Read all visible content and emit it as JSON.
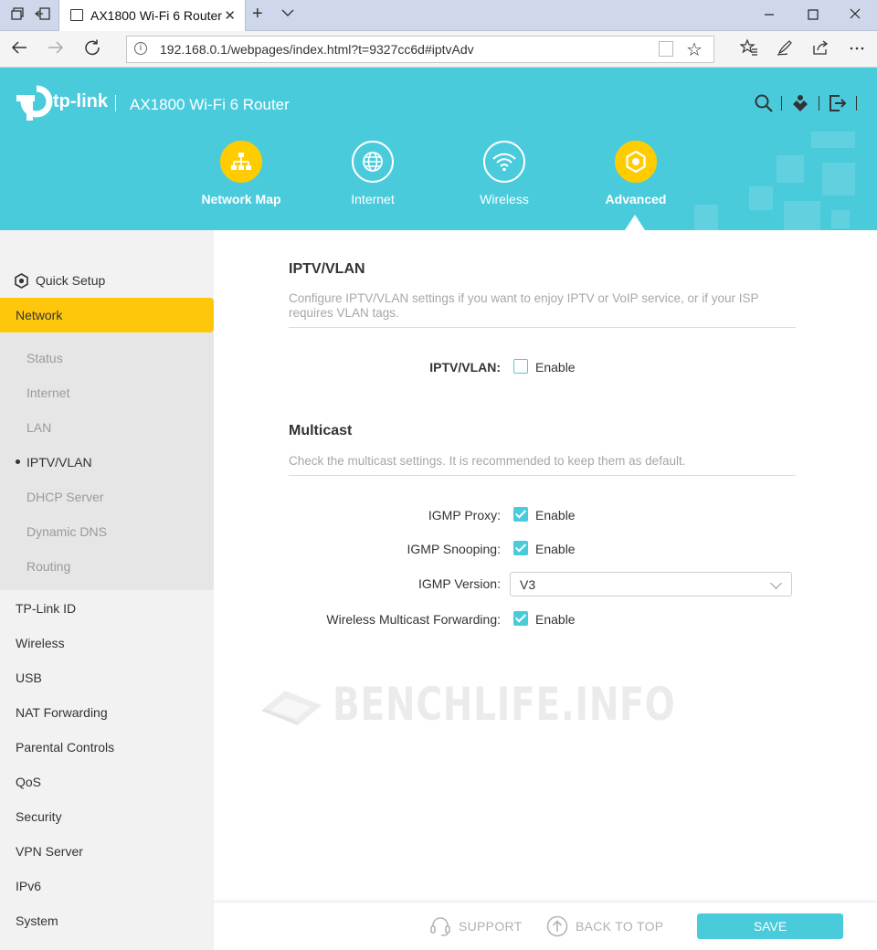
{
  "browser": {
    "tab_title": "AX1800 Wi-Fi 6 Router",
    "url": "192.168.0.1/webpages/index.html?t=9327cc6d#iptvAdv"
  },
  "header": {
    "brand": "tp-link",
    "model": "AX1800 Wi-Fi 6 Router",
    "nav": [
      {
        "label": "Network Map",
        "icon": "network-map-icon"
      },
      {
        "label": "Internet",
        "icon": "globe-icon"
      },
      {
        "label": "Wireless",
        "icon": "wifi-icon"
      },
      {
        "label": "Advanced",
        "icon": "gear-icon"
      }
    ],
    "active_nav": "Advanced"
  },
  "sidebar": {
    "quick_setup": "Quick Setup",
    "active_section": "Network",
    "network_sub": [
      "Status",
      "Internet",
      "LAN",
      "IPTV/VLAN",
      "DHCP Server",
      "Dynamic DNS",
      "Routing"
    ],
    "current_sub": "IPTV/VLAN",
    "items": [
      "TP-Link ID",
      "Wireless",
      "USB",
      "NAT Forwarding",
      "Parental Controls",
      "QoS",
      "Security",
      "VPN Server",
      "IPv6",
      "System"
    ]
  },
  "iptv": {
    "title": "IPTV/VLAN",
    "description": "Configure IPTV/VLAN settings if you want to enjoy IPTV or VoIP service, or if your ISP requires VLAN tags.",
    "label": "IPTV/VLAN:",
    "enable_text": "Enable",
    "enabled": false
  },
  "multicast": {
    "title": "Multicast",
    "description": "Check the multicast settings. It is recommended to keep them as default.",
    "igmp_proxy_label": "IGMP Proxy:",
    "igmp_snooping_label": "IGMP Snooping:",
    "igmp_version_label": "IGMP Version:",
    "igmp_version_value": "V3",
    "wireless_forwarding_label": "Wireless Multicast Forwarding:",
    "enable_text": "Enable",
    "igmp_proxy": true,
    "igmp_snooping": true,
    "wireless_forwarding": true
  },
  "watermark": "BENCHLIFE.INFO",
  "footer": {
    "support": "SUPPORT",
    "back_to_top": "BACK TO TOP",
    "save": "SAVE"
  },
  "colors": {
    "accent": "#4acbdc",
    "highlight": "#ffc70b"
  }
}
